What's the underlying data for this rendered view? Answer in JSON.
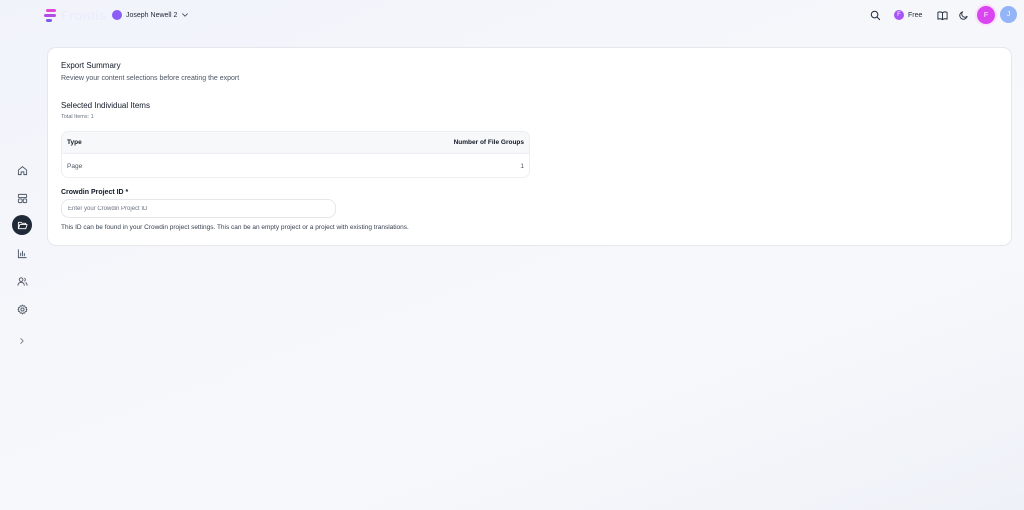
{
  "app": {
    "logo_text": "Frontis"
  },
  "workspace": {
    "name": "Joseph Newell 2"
  },
  "header": {
    "plan_label": "Free",
    "plan_icon_glyph": "F",
    "user_initial": "J",
    "brand_initial": "F"
  },
  "colors": {
    "accent": "#d946ef",
    "brand_purple": "#8b5cf6",
    "sidebar_active": "#1f2937",
    "user_avatar": "#93b4f7"
  },
  "sidebar": {
    "items": [
      {
        "icon": "home-icon"
      },
      {
        "icon": "layout-icon"
      },
      {
        "icon": "folder-open-icon",
        "active": true
      },
      {
        "icon": "bar-chart-icon"
      },
      {
        "icon": "users-icon"
      },
      {
        "icon": "gear-icon"
      },
      {
        "icon": "chevron-right-icon"
      }
    ]
  },
  "export_summary": {
    "title": "Export Summary",
    "subtitle": "Review your content selections before creating the export",
    "section_title": "Selected Individual Items",
    "total_items": "Total Items: 1",
    "table": {
      "columns": [
        "Type",
        "Number of File Groups"
      ],
      "rows": [
        {
          "type": "Page",
          "file_groups": "1"
        }
      ]
    },
    "project_field": {
      "label": "Crowdin Project ID *",
      "placeholder": "Enter your Crowdin Project ID",
      "value": "",
      "help": "This ID can be found in your Crowdin project settings. This can be an empty project or a project with existing translations."
    }
  }
}
